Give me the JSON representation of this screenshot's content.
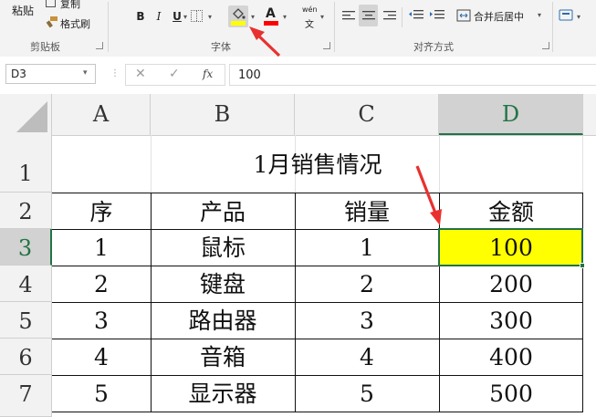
{
  "ribbon": {
    "paste": "粘贴",
    "copy": "复制",
    "format_painter": "格式刷",
    "group_clipboard": "剪贴板",
    "bold": "B",
    "italic": "I",
    "underline": "U",
    "font_color_glyph": "A",
    "phonetic_glyph": "wén",
    "group_font": "字体",
    "merge_center": "合并后居中",
    "group_alignment": "对齐方式",
    "fill_color": "#ffff00",
    "font_color": "#ff0000"
  },
  "formula_bar": {
    "name_box": "D3",
    "fx": "fx",
    "value": "100"
  },
  "sheet": {
    "columns": [
      "A",
      "B",
      "C",
      "D"
    ],
    "rows": [
      "1",
      "2",
      "3",
      "4",
      "5",
      "6",
      "7"
    ],
    "title": "1月销售情况",
    "headers": [
      "序",
      "产品",
      "销量",
      "金额"
    ],
    "data": [
      [
        "1",
        "鼠标",
        "1",
        "100"
      ],
      [
        "2",
        "键盘",
        "2",
        "200"
      ],
      [
        "3",
        "路由器",
        "3",
        "300"
      ],
      [
        "4",
        "音箱",
        "4",
        "400"
      ],
      [
        "5",
        "显示器",
        "5",
        "500"
      ]
    ],
    "selected_fill": "#ffff00",
    "selection_border": "#217346",
    "arrow_color": "#e8312f"
  }
}
